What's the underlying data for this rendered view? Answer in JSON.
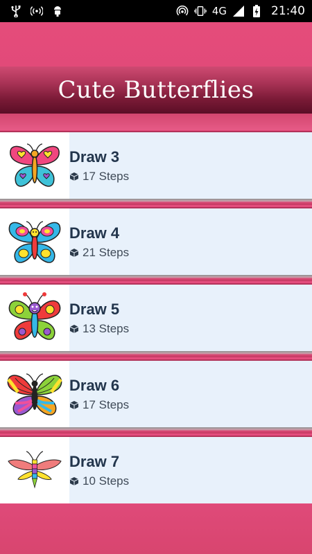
{
  "status_bar": {
    "network": "4G",
    "time": "21:40",
    "left_icons": [
      "usb-icon",
      "wifi-hotspot-icon",
      "android-debug-icon"
    ],
    "right_icons": [
      "hotspot-icon",
      "vibrate-icon",
      "signal-icon",
      "battery-icon"
    ]
  },
  "header": {
    "title": "Cute Butterflies"
  },
  "items": [
    {
      "title": "Draw 3",
      "steps": "17 Steps",
      "icon": "butterfly-hearts-icon"
    },
    {
      "title": "Draw 4",
      "steps": "21 Steps",
      "icon": "butterfly-blue-icon"
    },
    {
      "title": "Draw 5",
      "steps": "13 Steps",
      "icon": "butterfly-dots-icon"
    },
    {
      "title": "Draw 6",
      "steps": "17 Steps",
      "icon": "butterfly-rainbow-icon"
    },
    {
      "title": "Draw 7",
      "steps": "10 Steps",
      "icon": "butterfly-moth-icon"
    }
  ],
  "colors": {
    "background": "#e44d7d",
    "banner_dark": "#5a0e26",
    "card": "#e8f1fb",
    "title_text": "#22354c"
  }
}
